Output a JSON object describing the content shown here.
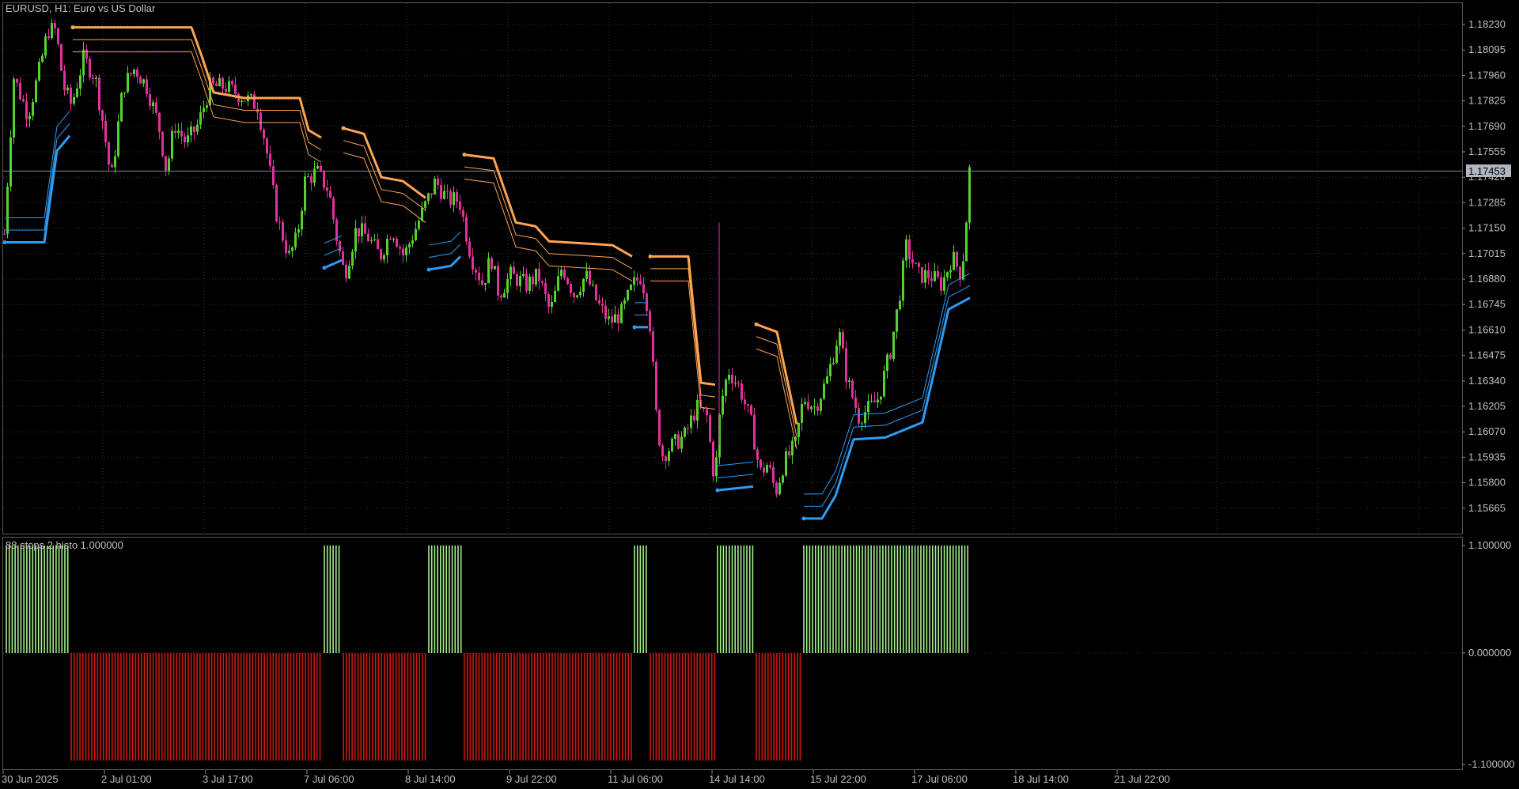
{
  "window": {
    "symbol_title": "EURUSD, H1:  Euro vs US Dollar",
    "indicator_title": "88 stops 2 histo 1.000000"
  },
  "colors": {
    "background": "#000000",
    "grid": "#2a3a4a",
    "frame": "#5a5a5a",
    "bull_candle": "#55d22e",
    "bear_candle": "#e0329a",
    "upper_stop": "#ffa552",
    "lower_stop": "#2e9cf5",
    "histo_up": "#a6f08a",
    "histo_down": "#cc1a12",
    "bid_line": "#7f8a96",
    "price_tag_bg": "#b0b7bf",
    "price_tag_text": "#000000"
  },
  "price_axis": {
    "labels": [
      "1.18230",
      "1.18095",
      "1.17960",
      "1.17825",
      "1.17690",
      "1.17555",
      "1.17420",
      "1.17285",
      "1.17150",
      "1.17015",
      "1.16880",
      "1.16745",
      "1.16610",
      "1.16475",
      "1.16340",
      "1.16205",
      "1.16070",
      "1.15935",
      "1.15800",
      "1.15665"
    ],
    "current_price": "1.17453"
  },
  "indicator_axis": {
    "labels": [
      "1.100000",
      "0.000000",
      "-1.100000"
    ]
  },
  "time_axis": {
    "labels": [
      "30 Jun 2025",
      "2 Jul 01:00",
      "3 Jul 17:00",
      "7 Jul 06:00",
      "8 Jul 14:00",
      "9 Jul 22:00",
      "11 Jul 06:00",
      "14 Jul 14:00",
      "15 Jul 22:00",
      "17 Jul 06:00",
      "18 Jul 14:00",
      "21 Jul 22:00"
    ]
  },
  "chart_data": {
    "type": "candlestick",
    "symbol": "EURUSD",
    "timeframe": "H1",
    "ylim": [
      1.1558,
      1.1831
    ],
    "close_path": [
      {
        "t": 0,
        "p": 1.1712
      },
      {
        "t": 12,
        "p": 1.1795
      },
      {
        "t": 30,
        "p": 1.1775
      },
      {
        "t": 45,
        "p": 1.18
      },
      {
        "t": 55,
        "p": 1.182
      },
      {
        "t": 65,
        "p": 1.182
      },
      {
        "t": 75,
        "p": 1.179
      },
      {
        "t": 85,
        "p": 1.178
      },
      {
        "t": 100,
        "p": 1.1805
      },
      {
        "t": 115,
        "p": 1.1795
      },
      {
        "t": 125,
        "p": 1.177
      },
      {
        "t": 135,
        "p": 1.174
      },
      {
        "t": 150,
        "p": 1.179
      },
      {
        "t": 165,
        "p": 1.18
      },
      {
        "t": 180,
        "p": 1.179
      },
      {
        "t": 195,
        "p": 1.177
      },
      {
        "t": 205,
        "p": 1.1745
      },
      {
        "t": 215,
        "p": 1.177
      },
      {
        "t": 230,
        "p": 1.176
      },
      {
        "t": 245,
        "p": 1.177
      },
      {
        "t": 260,
        "p": 1.179
      },
      {
        "t": 280,
        "p": 1.179
      },
      {
        "t": 300,
        "p": 1.1785
      },
      {
        "t": 320,
        "p": 1.178
      },
      {
        "t": 330,
        "p": 1.176
      },
      {
        "t": 345,
        "p": 1.172
      },
      {
        "t": 360,
        "p": 1.17
      },
      {
        "t": 370,
        "p": 1.171
      },
      {
        "t": 380,
        "p": 1.174
      },
      {
        "t": 395,
        "p": 1.1745
      },
      {
        "t": 410,
        "p": 1.1735
      },
      {
        "t": 420,
        "p": 1.171
      },
      {
        "t": 430,
        "p": 1.169
      },
      {
        "t": 445,
        "p": 1.1715
      },
      {
        "t": 460,
        "p": 1.171
      },
      {
        "t": 475,
        "p": 1.17
      },
      {
        "t": 490,
        "p": 1.1715
      },
      {
        "t": 505,
        "p": 1.17
      },
      {
        "t": 520,
        "p": 1.1715
      },
      {
        "t": 535,
        "p": 1.173
      },
      {
        "t": 545,
        "p": 1.174
      },
      {
        "t": 560,
        "p": 1.173
      },
      {
        "t": 575,
        "p": 1.173
      },
      {
        "t": 590,
        "p": 1.17
      },
      {
        "t": 605,
        "p": 1.1685
      },
      {
        "t": 615,
        "p": 1.17
      },
      {
        "t": 625,
        "p": 1.168
      },
      {
        "t": 640,
        "p": 1.169
      },
      {
        "t": 660,
        "p": 1.1685
      },
      {
        "t": 675,
        "p": 1.169
      },
      {
        "t": 690,
        "p": 1.167
      },
      {
        "t": 705,
        "p": 1.1695
      },
      {
        "t": 720,
        "p": 1.168
      },
      {
        "t": 735,
        "p": 1.169
      },
      {
        "t": 750,
        "p": 1.1675
      },
      {
        "t": 765,
        "p": 1.1665
      },
      {
        "t": 780,
        "p": 1.167
      },
      {
        "t": 795,
        "p": 1.1685
      },
      {
        "t": 805,
        "p": 1.169
      },
      {
        "t": 815,
        "p": 1.167
      },
      {
        "t": 820,
        "p": 1.164
      },
      {
        "t": 825,
        "p": 1.161
      },
      {
        "t": 832,
        "p": 1.1595
      },
      {
        "t": 845,
        "p": 1.16
      },
      {
        "t": 860,
        "p": 1.1605
      },
      {
        "t": 875,
        "p": 1.162
      },
      {
        "t": 888,
        "p": 1.1615
      },
      {
        "t": 898,
        "p": 1.158
      },
      {
        "t": 905,
        "p": 1.162
      },
      {
        "t": 915,
        "p": 1.164
      },
      {
        "t": 930,
        "p": 1.163
      },
      {
        "t": 945,
        "p": 1.161
      },
      {
        "t": 955,
        "p": 1.1585
      },
      {
        "t": 965,
        "p": 1.159
      },
      {
        "t": 975,
        "p": 1.1575
      },
      {
        "t": 985,
        "p": 1.159
      },
      {
        "t": 1000,
        "p": 1.16
      },
      {
        "t": 1010,
        "p": 1.1625
      },
      {
        "t": 1025,
        "p": 1.162
      },
      {
        "t": 1040,
        "p": 1.1635
      },
      {
        "t": 1055,
        "p": 1.166
      },
      {
        "t": 1065,
        "p": 1.1635
      },
      {
        "t": 1080,
        "p": 1.1615
      },
      {
        "t": 1095,
        "p": 1.162
      },
      {
        "t": 1105,
        "p": 1.1625
      },
      {
        "t": 1120,
        "p": 1.165
      },
      {
        "t": 1130,
        "p": 1.1675
      },
      {
        "t": 1140,
        "p": 1.1705
      },
      {
        "t": 1155,
        "p": 1.169
      },
      {
        "t": 1170,
        "p": 1.169
      },
      {
        "t": 1185,
        "p": 1.1685
      },
      {
        "t": 1198,
        "p": 1.17
      },
      {
        "t": 1210,
        "p": 1.169
      },
      {
        "t": 1216,
        "p": 1.172
      },
      {
        "t": 1221,
        "p": 1.1752
      }
    ],
    "upper_stop_segments": [
      [
        {
          "t": 88,
          "p": 1.18215
        },
        {
          "t": 238,
          "p": 1.18215
        },
        {
          "t": 252,
          "p": 1.1805
        },
        {
          "t": 266,
          "p": 1.1787
        },
        {
          "t": 305,
          "p": 1.1784
        },
        {
          "t": 375,
          "p": 1.1784
        },
        {
          "t": 386,
          "p": 1.1767
        },
        {
          "t": 402,
          "p": 1.1763
        }
      ],
      [
        {
          "t": 430,
          "p": 1.1768
        },
        {
          "t": 456,
          "p": 1.1765
        },
        {
          "t": 478,
          "p": 1.1742
        },
        {
          "t": 505,
          "p": 1.174
        },
        {
          "t": 534,
          "p": 1.1731
        }
      ],
      [
        {
          "t": 583,
          "p": 1.1754
        },
        {
          "t": 620,
          "p": 1.1752
        },
        {
          "t": 648,
          "p": 1.1718
        },
        {
          "t": 673,
          "p": 1.1716
        },
        {
          "t": 690,
          "p": 1.1708
        },
        {
          "t": 770,
          "p": 1.1706
        },
        {
          "t": 795,
          "p": 1.17
        }
      ],
      [
        {
          "t": 818,
          "p": 1.17
        },
        {
          "t": 866,
          "p": 1.17
        },
        {
          "t": 882,
          "p": 1.1633
        },
        {
          "t": 900,
          "p": 1.1632
        }
      ],
      [
        {
          "t": 952,
          "p": 1.1664
        },
        {
          "t": 978,
          "p": 1.166
        },
        {
          "t": 1003,
          "p": 1.1611
        }
      ]
    ],
    "lower_stop_segments": [
      [
        {
          "t": 2,
          "p": 1.17075
        },
        {
          "t": 52,
          "p": 1.17075
        },
        {
          "t": 68,
          "p": 1.1756
        },
        {
          "t": 84,
          "p": 1.1764
        }
      ],
      [
        {
          "t": 406,
          "p": 1.1694
        },
        {
          "t": 428,
          "p": 1.1698
        }
      ],
      [
        {
          "t": 538,
          "p": 1.1693
        },
        {
          "t": 566,
          "p": 1.1695
        },
        {
          "t": 578,
          "p": 1.17
        }
      ],
      [
        {
          "t": 798,
          "p": 1.16625
        },
        {
          "t": 815,
          "p": 1.16625
        }
      ],
      [
        {
          "t": 903,
          "p": 1.1576
        },
        {
          "t": 948,
          "p": 1.1578
        }
      ],
      [
        {
          "t": 1012,
          "p": 1.1561
        },
        {
          "t": 1035,
          "p": 1.1561
        },
        {
          "t": 1052,
          "p": 1.1573
        },
        {
          "t": 1075,
          "p": 1.1603
        },
        {
          "t": 1115,
          "p": 1.1604
        },
        {
          "t": 1162,
          "p": 1.1612
        },
        {
          "t": 1195,
          "p": 1.1672
        },
        {
          "t": 1222,
          "p": 1.1678
        }
      ]
    ],
    "histogram_blocks": [
      {
        "from": 4,
        "to": 84,
        "value": 1.0
      },
      {
        "from": 86,
        "to": 402,
        "value": -1.0
      },
      {
        "from": 406,
        "to": 428,
        "value": 1.0
      },
      {
        "from": 430,
        "to": 534,
        "value": -1.0
      },
      {
        "from": 538,
        "to": 580,
        "value": 1.0
      },
      {
        "from": 583,
        "to": 795,
        "value": -1.0
      },
      {
        "from": 798,
        "to": 815,
        "value": 1.0
      },
      {
        "from": 818,
        "to": 900,
        "value": -1.0
      },
      {
        "from": 903,
        "to": 948,
        "value": 1.0
      },
      {
        "from": 952,
        "to": 1008,
        "value": -1.0
      },
      {
        "from": 1012,
        "to": 1222,
        "value": 1.0
      }
    ]
  }
}
